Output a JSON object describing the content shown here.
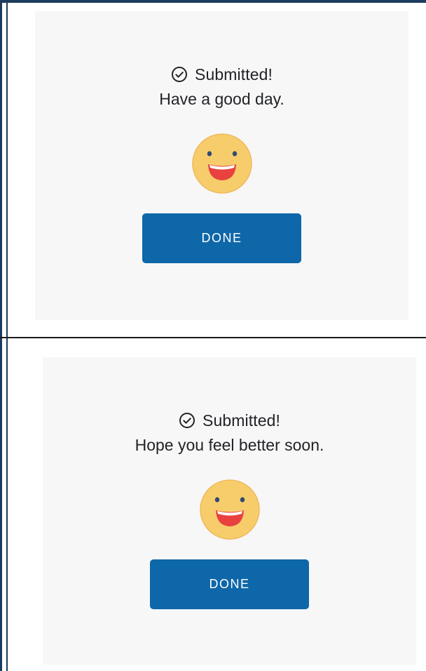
{
  "screens": [
    {
      "status_icon": "check-circle-icon",
      "status_title": "Submitted!",
      "message": "Have a good day.",
      "emoji": "smiling-face-icon",
      "done_label": "DONE"
    },
    {
      "status_icon": "check-circle-icon",
      "status_title": "Submitted!",
      "message": "Hope you feel better soon.",
      "emoji": "smiling-face-icon",
      "done_label": "DONE"
    }
  ],
  "colors": {
    "button": "#0e67a8",
    "panel_bg": "#f7f7f8",
    "frame": "#1c3c5e",
    "emoji_face": "#f7cd6b",
    "emoji_mouth": "#e8413f"
  }
}
